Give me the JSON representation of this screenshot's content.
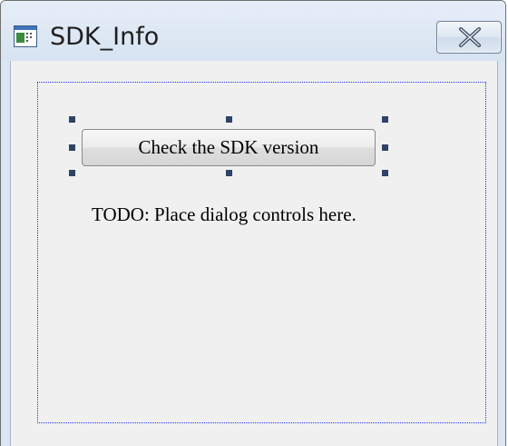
{
  "window": {
    "title": "SDK_Info",
    "icon": "dialog-app-icon",
    "close_icon": "close-x-icon"
  },
  "dialog": {
    "button_label": "Check the SDK version",
    "placeholder_text": "TODO: Place dialog controls here."
  },
  "colors": {
    "titlebar": "#dbe6f3",
    "client_bg": "#f0f0f0",
    "design_border": "#2233ee",
    "handle": "#2f4366"
  }
}
